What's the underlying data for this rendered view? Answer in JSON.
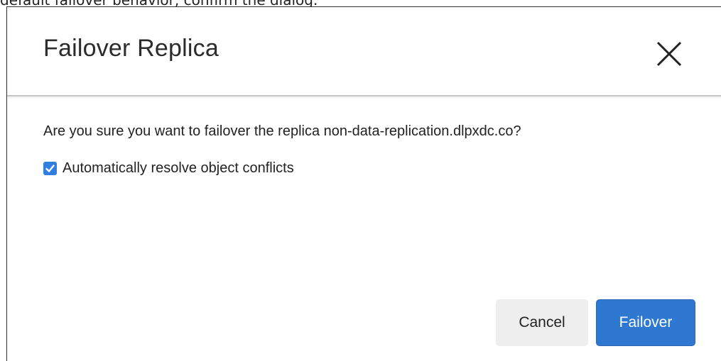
{
  "background_text": "default failover behavior, confirm the dialog.",
  "dialog": {
    "title": "Failover Replica",
    "close_icon": "close-icon",
    "message": "Are you sure you want to failover the replica non-data-replication.dlpxdc.co?",
    "option": {
      "label": "Automatically resolve object conflicts",
      "checked": true
    },
    "buttons": {
      "cancel_label": "Cancel",
      "failover_label": "Failover"
    },
    "colors": {
      "primary": "#2e78d2",
      "checkbox": "#2f7ee0",
      "cancel_bg": "#eeeeee"
    }
  }
}
